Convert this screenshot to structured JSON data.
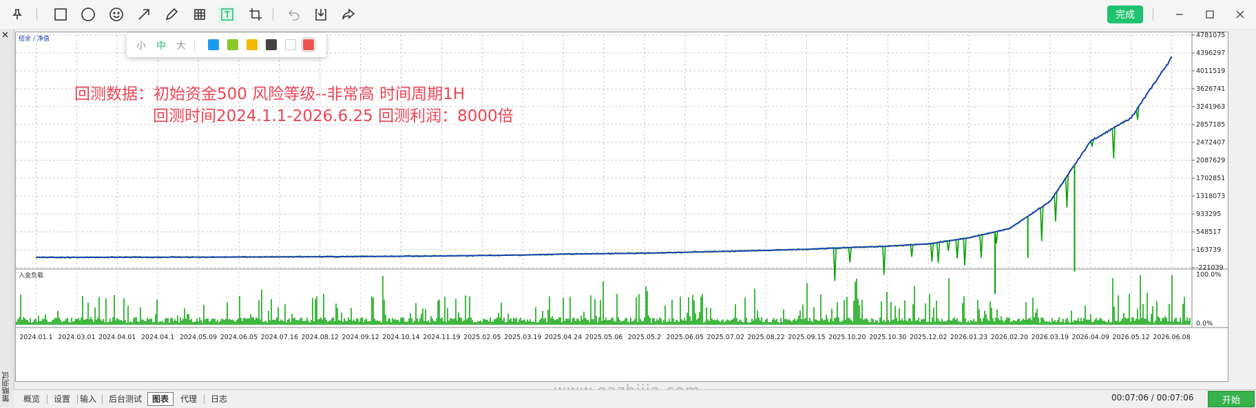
{
  "toolbar": {
    "tools": [
      "pin-icon",
      "rectangle-icon",
      "circle-icon",
      "emoji-icon",
      "arrow-icon",
      "pen-icon",
      "mosaic-icon",
      "text-icon",
      "crop-icon",
      "undo-icon",
      "save-icon",
      "share-icon"
    ],
    "done_label": "完成"
  },
  "text_popup": {
    "sizes": [
      "小",
      "中",
      "大"
    ],
    "selected_size": "中",
    "colors": [
      "#1e9bf0",
      "#8ac926",
      "#f5b800",
      "#444444",
      "#ffffff",
      "#ef5350"
    ],
    "selected_color": "#ef5350"
  },
  "annotation": {
    "line1": "回测数据：初始资金500   风险等级--非常高    时间周期1H",
    "line2": "回测时间2024.1.1-2026.6.25   回测利润：8000倍"
  },
  "chart_data": [
    {
      "type": "line",
      "legend": "结余 / 净值",
      "series": [
        {
          "name": "结余",
          "color": "#1a3fb0"
        },
        {
          "name": "净值",
          "color": "#00a000"
        }
      ],
      "x": [
        "2024.01.1",
        "2024.03.01",
        "2024.04.01",
        "2024.04.1",
        "2024.05.09",
        "2024.06.05",
        "2024.07.16",
        "2024.08.12",
        "2024.09.12",
        "2024.10.14",
        "2024.11.19",
        "2025.02.05",
        "2025.03.19",
        "2025.04.24",
        "2025.05.06",
        "2025.05.2",
        "2025.06.05",
        "2025.07.02",
        "2025.08.22",
        "2025.09.15",
        "2025.10.20",
        "2025.10.30",
        "2025.12.02",
        "2026.01.23",
        "2026.02.20",
        "2026.03.19",
        "2026.04.09",
        "2026.05.12",
        "2026.06.08"
      ],
      "balance": [
        0,
        1000,
        2000,
        3000,
        5000,
        8000,
        10000,
        14000,
        18000,
        24000,
        30000,
        40000,
        50000,
        70000,
        80000,
        90000,
        110000,
        130000,
        150000,
        175000,
        210000,
        240000,
        290000,
        420000,
        620000,
        1200000,
        2500000,
        3000000,
        4300000
      ],
      "yticks": [
        "4781075",
        "4396297",
        "4011519",
        "3626741",
        "3241963",
        "2857185",
        "2472407",
        "2087629",
        "1702851",
        "1318073",
        "933295",
        "548517",
        "163739",
        "-221039"
      ],
      "ylim": [
        -221039,
        4781075
      ]
    },
    {
      "type": "bar",
      "legend": "入金负载",
      "series": [
        {
          "name": "入金负载",
          "color": "#00a000"
        }
      ],
      "yticks": [
        "100.0%",
        "0.0%"
      ],
      "ylim": [
        0,
        100
      ]
    }
  ],
  "bottom_tabs": [
    "概览",
    "设置",
    "输入",
    "后台测试",
    "图表",
    "代理",
    "日志"
  ],
  "active_tab": "图表",
  "side_label": "策略测试",
  "timer": "00:07:06 / 00:07:06",
  "start_label": "开始",
  "watermark": "www.eazhijia.com"
}
